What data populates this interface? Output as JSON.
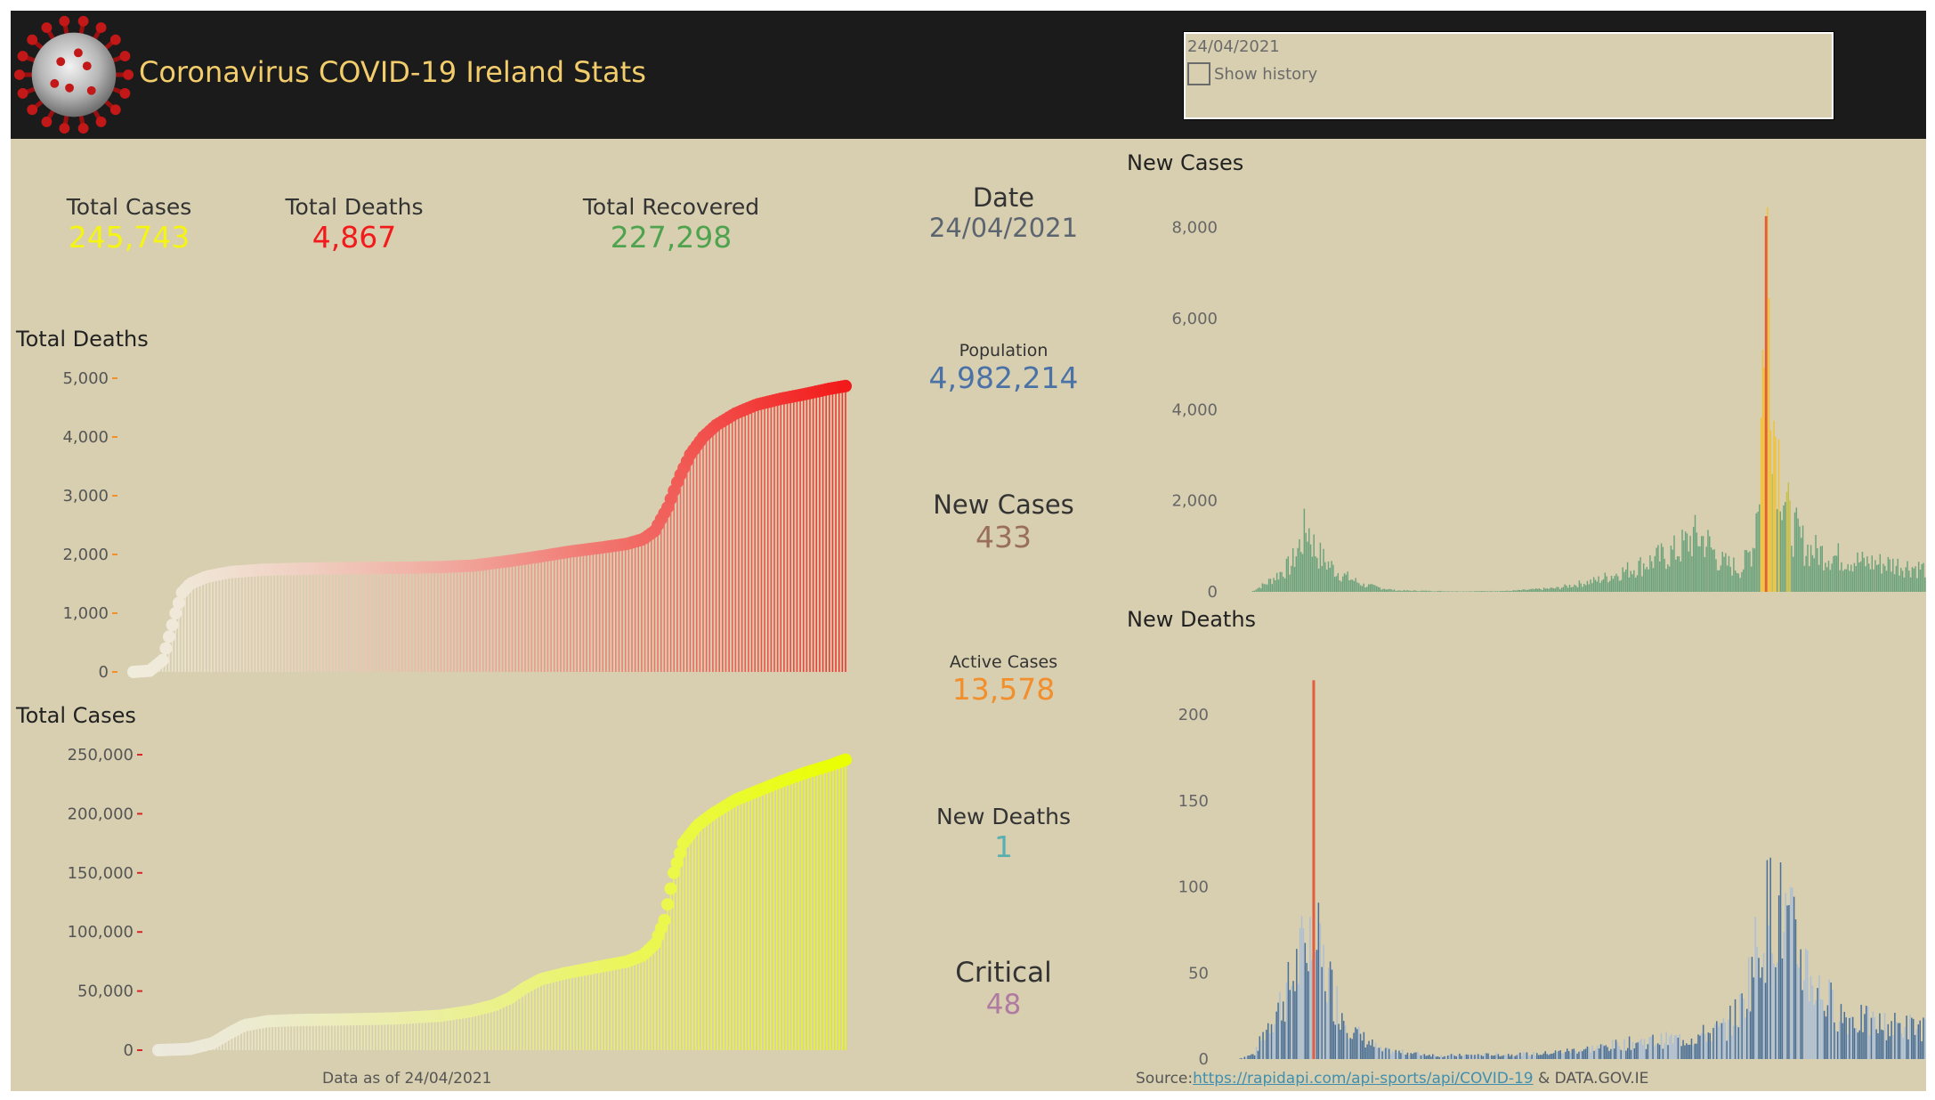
{
  "header": {
    "title": "Coronavirus COVID-19 Ireland Stats",
    "logo": "coronavirus-logo-icon"
  },
  "filter": {
    "date": "24/04/2021",
    "show_history_label": "Show history",
    "show_history_checked": false
  },
  "kpis": {
    "total_cases": {
      "label": "Total Cases",
      "value": "245,743",
      "color": "#f5f511"
    },
    "total_deaths": {
      "label": "Total Deaths",
      "value": "4,867",
      "color": "#f21a1a"
    },
    "total_recovered": {
      "label": "Total Recovered",
      "value": "227,298",
      "color": "#4fa34f"
    },
    "date": {
      "label": "Date",
      "value": "24/04/2021",
      "color": "#5c6470"
    },
    "population": {
      "label": "Population",
      "value": "4,982,214",
      "color": "#4a72a6"
    },
    "new_cases": {
      "label": "New Cases",
      "value": "433",
      "color": "#9a6f5a"
    },
    "active_cases": {
      "label": "Active Cases",
      "value": "13,578",
      "color": "#f28e2b"
    },
    "new_deaths": {
      "label": "New Deaths",
      "value": "1",
      "color": "#5aafb0"
    },
    "critical": {
      "label": "Critical",
      "value": "48",
      "color": "#b07aa1"
    }
  },
  "footer": {
    "data_as_of": "Data as of 24/04/2021",
    "source_prefix": "Source:",
    "source_link": "https://rapidapi.com/api-sports/api/COVID-19",
    "source_suffix": " & DATA.GOV.IE"
  },
  "chart_data": [
    {
      "id": "total-deaths",
      "type": "area",
      "title": "Total Deaths",
      "ylim": [
        0,
        5000
      ],
      "yticks": [
        "0",
        "1,000",
        "2,000",
        "3,000",
        "4,000",
        "5,000"
      ],
      "tick_color": "#f28e2b",
      "color_start": "#f0ecdc",
      "color_end": "#f21a1a",
      "grid": false,
      "points": [
        [
          0,
          0
        ],
        [
          10,
          20
        ],
        [
          18,
          200
        ],
        [
          22,
          600
        ],
        [
          26,
          1000
        ],
        [
          30,
          1350
        ],
        [
          35,
          1500
        ],
        [
          45,
          1620
        ],
        [
          60,
          1700
        ],
        [
          80,
          1740
        ],
        [
          110,
          1760
        ],
        [
          140,
          1770
        ],
        [
          170,
          1775
        ],
        [
          190,
          1785
        ],
        [
          210,
          1810
        ],
        [
          230,
          1880
        ],
        [
          250,
          1960
        ],
        [
          270,
          2050
        ],
        [
          290,
          2120
        ],
        [
          305,
          2180
        ],
        [
          315,
          2260
        ],
        [
          322,
          2400
        ],
        [
          330,
          2800
        ],
        [
          337,
          3300
        ],
        [
          344,
          3700
        ],
        [
          352,
          4000
        ],
        [
          360,
          4200
        ],
        [
          372,
          4400
        ],
        [
          385,
          4550
        ],
        [
          400,
          4650
        ],
        [
          415,
          4730
        ],
        [
          430,
          4820
        ],
        [
          440,
          4867
        ]
      ]
    },
    {
      "id": "total-cases",
      "type": "area",
      "title": "Total Cases",
      "ylim": [
        0,
        250000
      ],
      "yticks": [
        "0",
        "50,000",
        "100,000",
        "150,000",
        "200,000",
        "250,000"
      ],
      "tick_color": "#d62728",
      "color_start": "#ece9dd",
      "color_end": "#eaff00",
      "grid": false,
      "points": [
        [
          0,
          0
        ],
        [
          20,
          1000
        ],
        [
          35,
          6000
        ],
        [
          45,
          14000
        ],
        [
          55,
          21000
        ],
        [
          70,
          24500
        ],
        [
          90,
          25500
        ],
        [
          120,
          26000
        ],
        [
          150,
          26800
        ],
        [
          180,
          29000
        ],
        [
          200,
          33000
        ],
        [
          215,
          38000
        ],
        [
          225,
          44000
        ],
        [
          235,
          53000
        ],
        [
          245,
          60000
        ],
        [
          260,
          65000
        ],
        [
          280,
          70000
        ],
        [
          300,
          75000
        ],
        [
          310,
          80000
        ],
        [
          318,
          90000
        ],
        [
          324,
          110000
        ],
        [
          330,
          150000
        ],
        [
          336,
          175000
        ],
        [
          345,
          190000
        ],
        [
          355,
          200000
        ],
        [
          370,
          212000
        ],
        [
          385,
          220000
        ],
        [
          400,
          228000
        ],
        [
          415,
          235000
        ],
        [
          430,
          241000
        ],
        [
          440,
          245743
        ]
      ]
    },
    {
      "id": "new-cases",
      "type": "bar",
      "title": "New Cases",
      "ylim": [
        0,
        8500
      ],
      "yticks": [
        "0",
        "2,000",
        "4,000",
        "6,000",
        "8,000"
      ],
      "tick_values": [
        0,
        2000,
        4000,
        6000,
        8000
      ],
      "count": 420,
      "highlight_index": 320,
      "highlight_value": 8248,
      "peaks": [
        [
          0,
          0
        ],
        [
          10,
          200
        ],
        [
          25,
          600
        ],
        [
          30,
          1000
        ],
        [
          35,
          1450
        ],
        [
          40,
          900
        ],
        [
          45,
          700
        ],
        [
          55,
          400
        ],
        [
          70,
          150
        ],
        [
          90,
          30
        ],
        [
          130,
          10
        ],
        [
          160,
          20
        ],
        [
          190,
          80
        ],
        [
          215,
          250
        ],
        [
          240,
          550
        ],
        [
          265,
          900
        ],
        [
          275,
          1200
        ],
        [
          282,
          1150
        ],
        [
          292,
          650
        ],
        [
          305,
          500
        ],
        [
          312,
          1000
        ],
        [
          316,
          2500
        ],
        [
          318,
          5000
        ],
        [
          320,
          8248
        ],
        [
          322,
          6500
        ],
        [
          325,
          3800
        ],
        [
          330,
          2500
        ],
        [
          335,
          1500
        ],
        [
          345,
          950
        ],
        [
          360,
          800
        ],
        [
          380,
          650
        ],
        [
          400,
          600
        ],
        [
          420,
          500
        ]
      ]
    },
    {
      "id": "new-deaths",
      "type": "bar",
      "title": "New Deaths",
      "ylim": [
        0,
        230
      ],
      "yticks": [
        "0",
        "50",
        "100",
        "150",
        "200"
      ],
      "tick_values": [
        0,
        50,
        100,
        150,
        200
      ],
      "count": 410,
      "highlight_index": 45,
      "highlight_value": 220,
      "peaks": [
        [
          0,
          0
        ],
        [
          10,
          3
        ],
        [
          18,
          20
        ],
        [
          30,
          40
        ],
        [
          38,
          60
        ],
        [
          45,
          75
        ],
        [
          50,
          55
        ],
        [
          60,
          30
        ],
        [
          70,
          15
        ],
        [
          85,
          5
        ],
        [
          120,
          2
        ],
        [
          180,
          3
        ],
        [
          210,
          6
        ],
        [
          240,
          10
        ],
        [
          270,
          12
        ],
        [
          290,
          18
        ],
        [
          300,
          30
        ],
        [
          305,
          50
        ],
        [
          312,
          75
        ],
        [
          318,
          90
        ],
        [
          325,
          80
        ],
        [
          335,
          60
        ],
        [
          345,
          40
        ],
        [
          360,
          25
        ],
        [
          380,
          20
        ],
        [
          410,
          18
        ]
      ]
    }
  ]
}
